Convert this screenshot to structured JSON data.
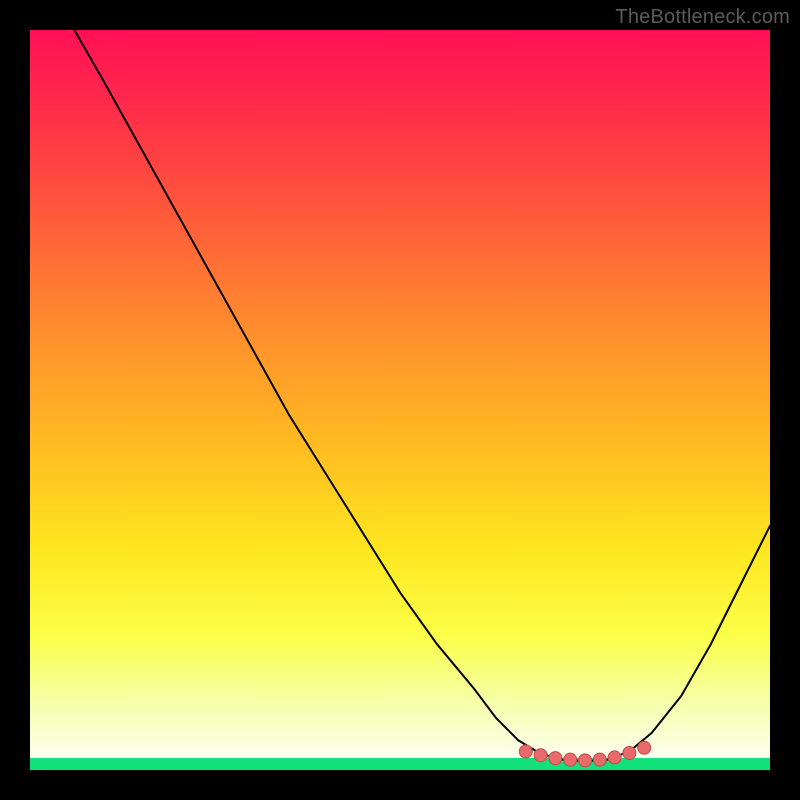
{
  "watermark": "TheBottleneck.com",
  "colors": {
    "background_black": "#000000",
    "gradient_top": "#ff1055",
    "gradient_mid1": "#ff8c2e",
    "gradient_mid2": "#ffe61f",
    "gradient_bottom": "#f5ffb5",
    "green_band": "#12e07a",
    "curve": "#000000",
    "markers": "#e86a6a"
  },
  "chart_data": {
    "type": "line",
    "title": "",
    "xlabel": "",
    "ylabel": "",
    "xlim": [
      0,
      100
    ],
    "ylim": [
      0,
      100
    ],
    "grid": false,
    "legend": false,
    "curve_points": [
      {
        "x": 6,
        "y": 100
      },
      {
        "x": 10,
        "y": 93
      },
      {
        "x": 15,
        "y": 84
      },
      {
        "x": 20,
        "y": 75
      },
      {
        "x": 25,
        "y": 66
      },
      {
        "x": 30,
        "y": 57
      },
      {
        "x": 35,
        "y": 48
      },
      {
        "x": 40,
        "y": 40
      },
      {
        "x": 45,
        "y": 32
      },
      {
        "x": 50,
        "y": 24
      },
      {
        "x": 55,
        "y": 17
      },
      {
        "x": 60,
        "y": 11
      },
      {
        "x": 63,
        "y": 7
      },
      {
        "x": 66,
        "y": 4
      },
      {
        "x": 69,
        "y": 2.2
      },
      {
        "x": 72,
        "y": 1.4
      },
      {
        "x": 75,
        "y": 1.2
      },
      {
        "x": 78,
        "y": 1.4
      },
      {
        "x": 81,
        "y": 2.5
      },
      {
        "x": 84,
        "y": 5
      },
      {
        "x": 88,
        "y": 10
      },
      {
        "x": 92,
        "y": 17
      },
      {
        "x": 96,
        "y": 25
      },
      {
        "x": 100,
        "y": 33
      }
    ],
    "markers": [
      {
        "x": 67,
        "y": 2.5
      },
      {
        "x": 69,
        "y": 2.0
      },
      {
        "x": 71,
        "y": 1.6
      },
      {
        "x": 73,
        "y": 1.4
      },
      {
        "x": 75,
        "y": 1.3
      },
      {
        "x": 77,
        "y": 1.4
      },
      {
        "x": 79,
        "y": 1.7
      },
      {
        "x": 81,
        "y": 2.3
      },
      {
        "x": 83,
        "y": 3.0
      }
    ]
  }
}
